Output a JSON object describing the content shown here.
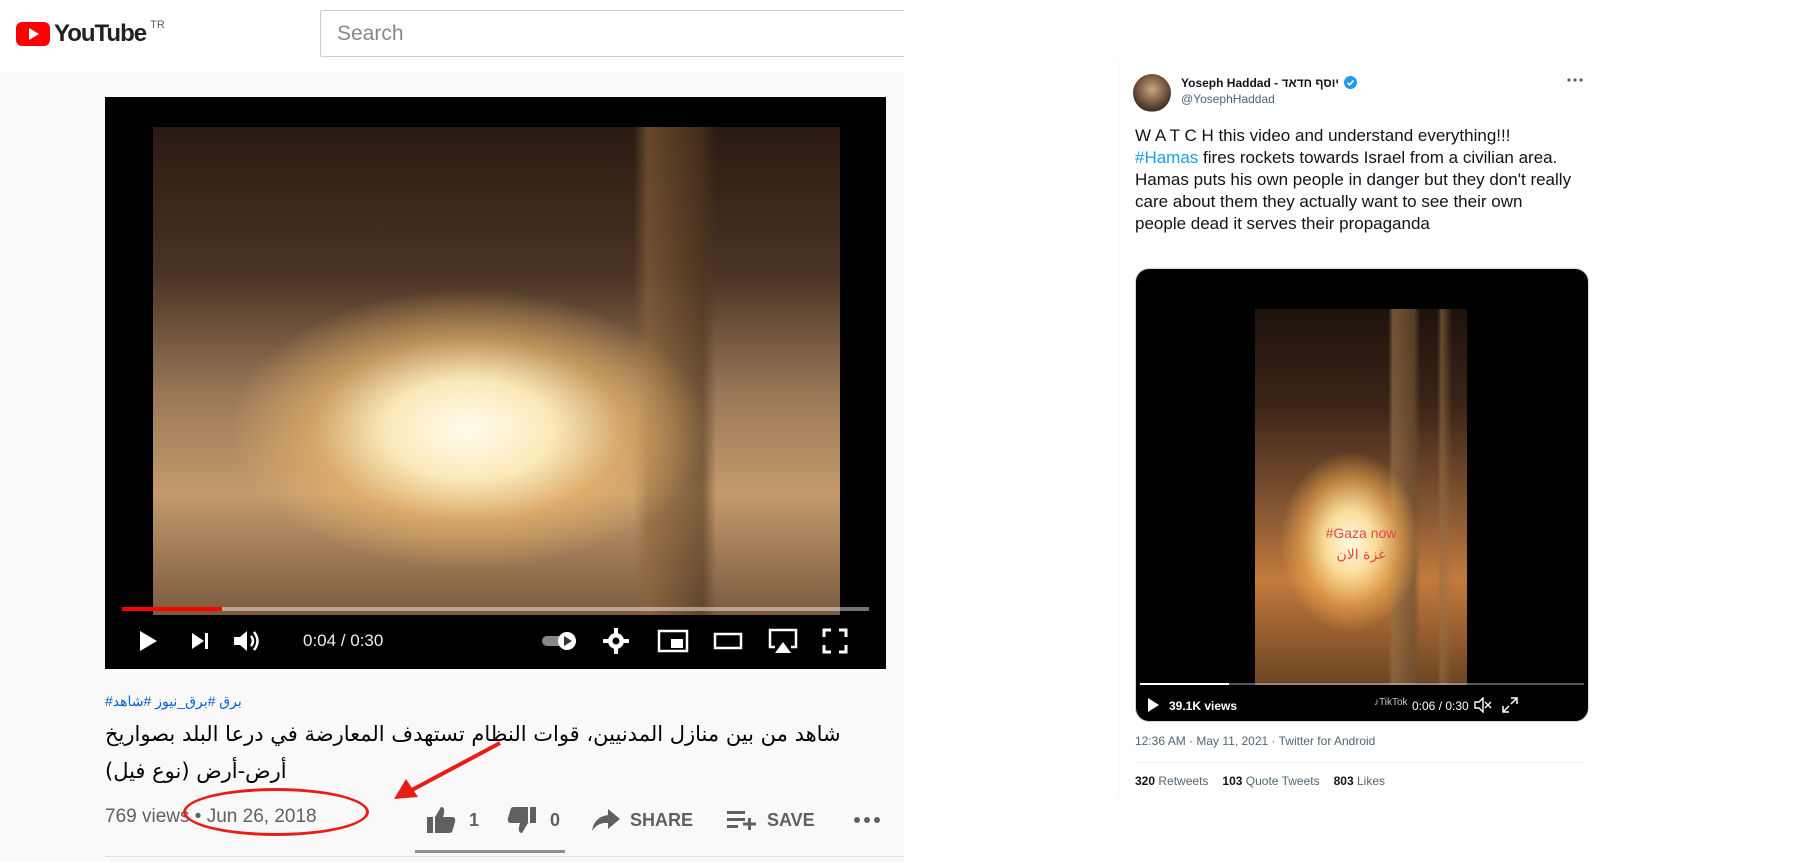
{
  "youtube": {
    "logo_text": "YouTube",
    "country_code": "TR",
    "search_placeholder": "Search",
    "player": {
      "time_display": "0:04 / 0:30",
      "progress_fraction": 0.1333
    },
    "hashtags": "#برق #برق_نيوز #شاهد",
    "title": "شاهد من بين منازل المدنيين، قوات النظام تستهدف المعارضة في درعا البلد بصواريخ أرض-أرض (نوع فيل)",
    "views": "769 views",
    "separator": "•",
    "date": "Jun 26, 2018",
    "likes": "1",
    "dislikes": "0",
    "share_label": "SHARE",
    "save_label": "SAVE",
    "annotation_color": "#e81e16"
  },
  "tweet": {
    "display_name": "Yoseph Haddad - יוסף חדאד",
    "handle": "@YosephHaddad",
    "text_line1": "W A T C H this video and understand everything!!!",
    "hashtag": "#Hamas",
    "text_line2_rest": " fires rockets towards Israel from a civilian area.",
    "text_line3": "Hamas puts his own people in danger but they don't really care about them they actually want to see their own people dead it serves their propaganda",
    "video": {
      "overlay_hashtag": "#Gaza now",
      "overlay_arabic": "غزة الان",
      "views": "39.1K views",
      "time_display": "0:06 / 0:30",
      "progress_fraction": 0.2,
      "watermark": "TikTok"
    },
    "timestamp": "12:36 AM · May 11, 2021 · Twitter for Android",
    "retweets_count": "320",
    "retweets_label": "Retweets",
    "quotes_count": "103",
    "quotes_label": "Quote Tweets",
    "likes_count": "803",
    "likes_label": "Likes",
    "accent_color": "#1d9bf0"
  }
}
